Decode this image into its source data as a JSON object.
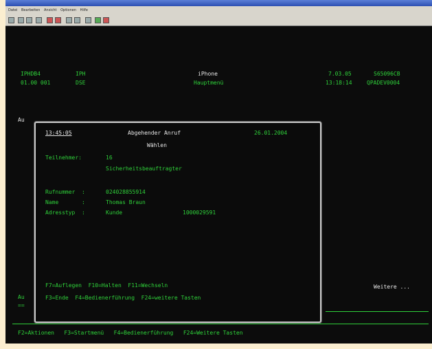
{
  "window": {
    "menu": [
      "Datei",
      "Bearbeiten",
      "Ansicht",
      "Optionen",
      "Hilfe"
    ]
  },
  "header": {
    "left_1": "IPHDB4",
    "left_2": "IPH",
    "left_3": "01.00 001",
    "left_4": "DSE",
    "center_title": "iPhone",
    "center_sub": "Hauptmenü",
    "right_date": "7.03.05",
    "right_id": "S65096CB",
    "right_time": "13:18:14",
    "right_sys": "QPADEV0004"
  },
  "background": {
    "side_label_1": "Au",
    "side_label_2": "Au",
    "side_label_3": "==",
    "weitere": "Weitere ...",
    "footer": "F2=Aktionen   F3=Startmenü   F4=Bedienerführung   F24=Weitere Tasten"
  },
  "dialog": {
    "time": "13:45:05",
    "title": "Abgehender Anruf",
    "date": "26.01.2004",
    "subtitle": "Wählen",
    "teilnehmer_label": "Teilnehmer:",
    "teilnehmer_value": "16",
    "role": "Sicherheitsbeauftragter",
    "rufnummer_label": "Rufnummer  :",
    "rufnummer_value": "024028855914",
    "name_label": "Name       :",
    "name_value": "Thomas Braun",
    "adresstyp_label": "Adresstyp  :",
    "adresstyp_value": "Kunde",
    "adresstyp_number": "1000029591",
    "keys_1": "F7=Auflegen  F10=Halten  F11=Wechseln",
    "keys_2": "F3=Ende  F4=Bedienerführung  F24=weitere Tasten"
  }
}
